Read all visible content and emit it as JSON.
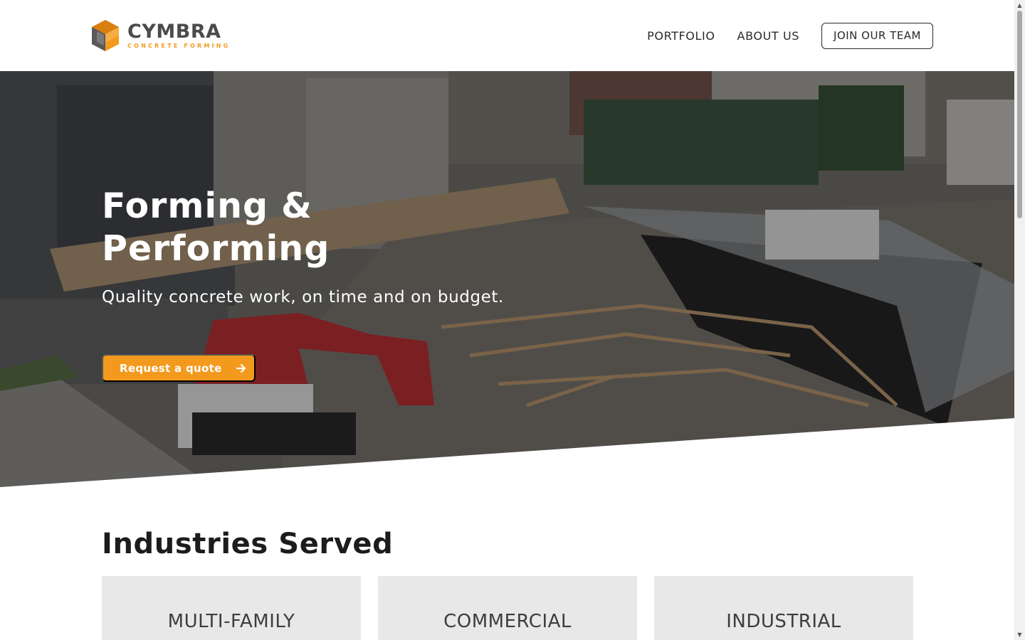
{
  "brand": {
    "name": "CYMBRA",
    "tagline": "CONCRETE FORMING",
    "colors": {
      "orange": "#f39a1e",
      "gray": "#4b4b4b"
    }
  },
  "nav": {
    "items": [
      {
        "label": "PORTFOLIO"
      },
      {
        "label": "ABOUT US"
      }
    ],
    "cta_label": "JOIN OUR TEAM"
  },
  "hero": {
    "title": "Forming & Performing",
    "subtitle": "Quality concrete work, on time and on budget.",
    "button_label": "Request a quote",
    "button_icon": "arrow-right-icon",
    "background": "aerial photo of construction site with excavator and concrete forms"
  },
  "industries": {
    "heading": "Industries Served",
    "cards": [
      {
        "label": "MULTI-FAMILY"
      },
      {
        "label": "COMMERCIAL"
      },
      {
        "label": "INDUSTRIAL"
      }
    ]
  }
}
